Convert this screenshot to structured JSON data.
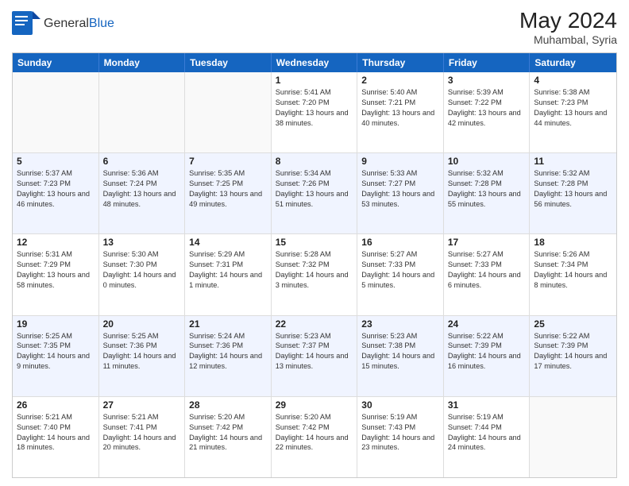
{
  "logo": {
    "general": "General",
    "blue": "Blue"
  },
  "title": {
    "month_year": "May 2024",
    "location": "Muhambal, Syria"
  },
  "days_of_week": [
    "Sunday",
    "Monday",
    "Tuesday",
    "Wednesday",
    "Thursday",
    "Friday",
    "Saturday"
  ],
  "weeks": [
    [
      {
        "day": "",
        "sunrise": "",
        "sunset": "",
        "daylight": ""
      },
      {
        "day": "",
        "sunrise": "",
        "sunset": "",
        "daylight": ""
      },
      {
        "day": "",
        "sunrise": "",
        "sunset": "",
        "daylight": ""
      },
      {
        "day": "1",
        "sunrise": "Sunrise: 5:41 AM",
        "sunset": "Sunset: 7:20 PM",
        "daylight": "Daylight: 13 hours and 38 minutes."
      },
      {
        "day": "2",
        "sunrise": "Sunrise: 5:40 AM",
        "sunset": "Sunset: 7:21 PM",
        "daylight": "Daylight: 13 hours and 40 minutes."
      },
      {
        "day": "3",
        "sunrise": "Sunrise: 5:39 AM",
        "sunset": "Sunset: 7:22 PM",
        "daylight": "Daylight: 13 hours and 42 minutes."
      },
      {
        "day": "4",
        "sunrise": "Sunrise: 5:38 AM",
        "sunset": "Sunset: 7:23 PM",
        "daylight": "Daylight: 13 hours and 44 minutes."
      }
    ],
    [
      {
        "day": "5",
        "sunrise": "Sunrise: 5:37 AM",
        "sunset": "Sunset: 7:23 PM",
        "daylight": "Daylight: 13 hours and 46 minutes."
      },
      {
        "day": "6",
        "sunrise": "Sunrise: 5:36 AM",
        "sunset": "Sunset: 7:24 PM",
        "daylight": "Daylight: 13 hours and 48 minutes."
      },
      {
        "day": "7",
        "sunrise": "Sunrise: 5:35 AM",
        "sunset": "Sunset: 7:25 PM",
        "daylight": "Daylight: 13 hours and 49 minutes."
      },
      {
        "day": "8",
        "sunrise": "Sunrise: 5:34 AM",
        "sunset": "Sunset: 7:26 PM",
        "daylight": "Daylight: 13 hours and 51 minutes."
      },
      {
        "day": "9",
        "sunrise": "Sunrise: 5:33 AM",
        "sunset": "Sunset: 7:27 PM",
        "daylight": "Daylight: 13 hours and 53 minutes."
      },
      {
        "day": "10",
        "sunrise": "Sunrise: 5:32 AM",
        "sunset": "Sunset: 7:28 PM",
        "daylight": "Daylight: 13 hours and 55 minutes."
      },
      {
        "day": "11",
        "sunrise": "Sunrise: 5:32 AM",
        "sunset": "Sunset: 7:28 PM",
        "daylight": "Daylight: 13 hours and 56 minutes."
      }
    ],
    [
      {
        "day": "12",
        "sunrise": "Sunrise: 5:31 AM",
        "sunset": "Sunset: 7:29 PM",
        "daylight": "Daylight: 13 hours and 58 minutes."
      },
      {
        "day": "13",
        "sunrise": "Sunrise: 5:30 AM",
        "sunset": "Sunset: 7:30 PM",
        "daylight": "Daylight: 14 hours and 0 minutes."
      },
      {
        "day": "14",
        "sunrise": "Sunrise: 5:29 AM",
        "sunset": "Sunset: 7:31 PM",
        "daylight": "Daylight: 14 hours and 1 minute."
      },
      {
        "day": "15",
        "sunrise": "Sunrise: 5:28 AM",
        "sunset": "Sunset: 7:32 PM",
        "daylight": "Daylight: 14 hours and 3 minutes."
      },
      {
        "day": "16",
        "sunrise": "Sunrise: 5:27 AM",
        "sunset": "Sunset: 7:33 PM",
        "daylight": "Daylight: 14 hours and 5 minutes."
      },
      {
        "day": "17",
        "sunrise": "Sunrise: 5:27 AM",
        "sunset": "Sunset: 7:33 PM",
        "daylight": "Daylight: 14 hours and 6 minutes."
      },
      {
        "day": "18",
        "sunrise": "Sunrise: 5:26 AM",
        "sunset": "Sunset: 7:34 PM",
        "daylight": "Daylight: 14 hours and 8 minutes."
      }
    ],
    [
      {
        "day": "19",
        "sunrise": "Sunrise: 5:25 AM",
        "sunset": "Sunset: 7:35 PM",
        "daylight": "Daylight: 14 hours and 9 minutes."
      },
      {
        "day": "20",
        "sunrise": "Sunrise: 5:25 AM",
        "sunset": "Sunset: 7:36 PM",
        "daylight": "Daylight: 14 hours and 11 minutes."
      },
      {
        "day": "21",
        "sunrise": "Sunrise: 5:24 AM",
        "sunset": "Sunset: 7:36 PM",
        "daylight": "Daylight: 14 hours and 12 minutes."
      },
      {
        "day": "22",
        "sunrise": "Sunrise: 5:23 AM",
        "sunset": "Sunset: 7:37 PM",
        "daylight": "Daylight: 14 hours and 13 minutes."
      },
      {
        "day": "23",
        "sunrise": "Sunrise: 5:23 AM",
        "sunset": "Sunset: 7:38 PM",
        "daylight": "Daylight: 14 hours and 15 minutes."
      },
      {
        "day": "24",
        "sunrise": "Sunrise: 5:22 AM",
        "sunset": "Sunset: 7:39 PM",
        "daylight": "Daylight: 14 hours and 16 minutes."
      },
      {
        "day": "25",
        "sunrise": "Sunrise: 5:22 AM",
        "sunset": "Sunset: 7:39 PM",
        "daylight": "Daylight: 14 hours and 17 minutes."
      }
    ],
    [
      {
        "day": "26",
        "sunrise": "Sunrise: 5:21 AM",
        "sunset": "Sunset: 7:40 PM",
        "daylight": "Daylight: 14 hours and 18 minutes."
      },
      {
        "day": "27",
        "sunrise": "Sunrise: 5:21 AM",
        "sunset": "Sunset: 7:41 PM",
        "daylight": "Daylight: 14 hours and 20 minutes."
      },
      {
        "day": "28",
        "sunrise": "Sunrise: 5:20 AM",
        "sunset": "Sunset: 7:42 PM",
        "daylight": "Daylight: 14 hours and 21 minutes."
      },
      {
        "day": "29",
        "sunrise": "Sunrise: 5:20 AM",
        "sunset": "Sunset: 7:42 PM",
        "daylight": "Daylight: 14 hours and 22 minutes."
      },
      {
        "day": "30",
        "sunrise": "Sunrise: 5:19 AM",
        "sunset": "Sunset: 7:43 PM",
        "daylight": "Daylight: 14 hours and 23 minutes."
      },
      {
        "day": "31",
        "sunrise": "Sunrise: 5:19 AM",
        "sunset": "Sunset: 7:44 PM",
        "daylight": "Daylight: 14 hours and 24 minutes."
      },
      {
        "day": "",
        "sunrise": "",
        "sunset": "",
        "daylight": ""
      }
    ]
  ]
}
